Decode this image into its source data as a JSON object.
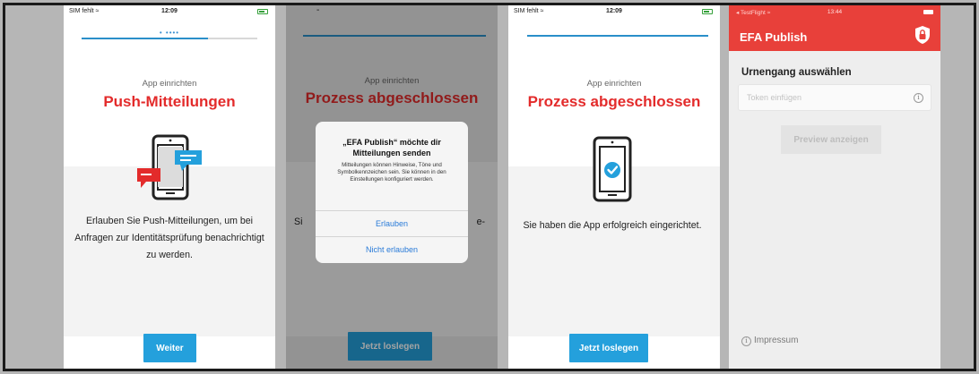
{
  "colors": {
    "brand_red": "#e32b2b",
    "button_blue": "#24a0dc",
    "link_blue": "#2a7bd8",
    "header_red": "#e8403a"
  },
  "screen1": {
    "status": {
      "carrier": "SIM fehlt ≈",
      "time": "12:09"
    },
    "dots": "• ••••",
    "progress": 0.72,
    "eyebrow": "App einrichten",
    "title": "Push-Mitteilungen",
    "body": "Erlauben Sie Push-Mitteilungen, um bei Anfragen zur Identitätsprüfung benachrichtigt zu werden.",
    "button": "Weiter",
    "icons": [
      "phone-with-chat-bubbles-icon"
    ]
  },
  "screen2": {
    "status": {
      "dash": "-"
    },
    "progress": 1.0,
    "eyebrow": "App einrichten",
    "title": "Prozess abgeschlossen",
    "peek_left": "Si",
    "peek_right": "e-",
    "alert": {
      "title": "„EFA Publish“ möchte dir Mitteilungen senden",
      "message": "Mitteilungen können Hinweise, Töne und Symbolkennzeichen sein. Sie können in den Einstellungen konfiguriert werden.",
      "allow": "Erlauben",
      "deny": "Nicht erlauben"
    },
    "button": "Jetzt loslegen"
  },
  "screen3": {
    "status": {
      "carrier": "SIM fehlt ≈",
      "time": "12:09"
    },
    "eyebrow": "App einrichten",
    "title": "Prozess abgeschlossen",
    "body": "Sie haben die App erfolgreich eingerichtet.",
    "button": "Jetzt loslegen",
    "icons": [
      "phone-checkmark-icon"
    ]
  },
  "screen4": {
    "status": {
      "testflight": "◂ TestFlight ≈",
      "time": "13:44"
    },
    "title": "EFA Publish",
    "section": "Urnengang auswählen",
    "token_placeholder": "Token einfügen",
    "preview_button": "Preview anzeigen",
    "impressum": "Impressum",
    "icons": [
      "lock-icon",
      "info-icon"
    ]
  }
}
